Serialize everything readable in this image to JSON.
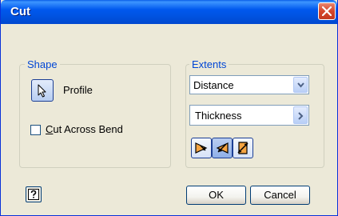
{
  "window": {
    "title": "Cut"
  },
  "shape": {
    "group_label": "Shape",
    "profile_label": "Profile",
    "cut_across_bend": {
      "label_accel": "C",
      "label_rest": "ut Across Bend",
      "checked": false
    }
  },
  "extents": {
    "group_label": "Extents",
    "extent_type": "Distance",
    "thickness": "Thickness",
    "direction_buttons": [
      "direction-1",
      "direction-2",
      "symmetric"
    ]
  },
  "buttons": {
    "ok": "OK",
    "cancel": "Cancel"
  },
  "colors": {
    "title_bar": "#0054e3",
    "group_label": "#0046d5",
    "dialog_bg": "#ece9d8",
    "close_button": "#d5462b",
    "direction_arrow": "#e07a10"
  }
}
